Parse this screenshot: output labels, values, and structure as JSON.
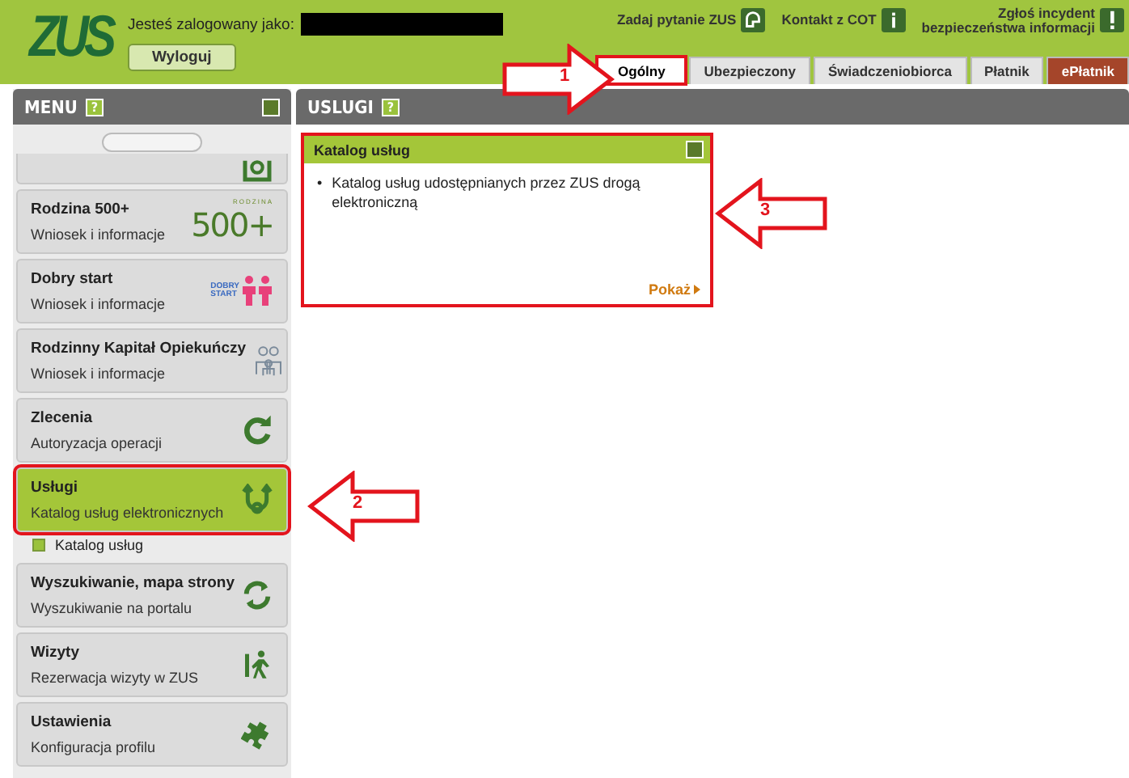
{
  "header": {
    "logo": "ZUS",
    "login_label": "Jesteś zalogowany jako:",
    "logout_button": "Wyloguj",
    "links": [
      {
        "kind": "question",
        "label": "Zadaj pytanie ZUS"
      },
      {
        "kind": "info",
        "label": "Kontakt z COT"
      },
      {
        "kind": "alert",
        "label": "Zgłoś incydent\nbezpieczeństwa informacji"
      }
    ],
    "tabs": [
      {
        "label": "Ogólny",
        "selected": true,
        "kind": "normal",
        "highlighted": true
      },
      {
        "label": "Ubezpieczony",
        "selected": false,
        "kind": "normal",
        "highlighted": false
      },
      {
        "label": "Świadczeniobiorca",
        "selected": false,
        "kind": "normal",
        "highlighted": false
      },
      {
        "label": "Płatnik",
        "selected": false,
        "kind": "normal",
        "highlighted": false
      },
      {
        "label": "ePłatnik",
        "selected": false,
        "kind": "special",
        "highlighted": false
      }
    ]
  },
  "sidebar": {
    "title": "MENU",
    "help": "?",
    "items": [
      {
        "kind": "partial"
      },
      {
        "kind": "item",
        "title": "Rodzina 500+",
        "subtitle": "Wniosek i informacje",
        "logo_lines": [
          "RODZINA",
          "500+"
        ],
        "selected": false,
        "highlighted": false
      },
      {
        "kind": "item",
        "title": "Dobry start",
        "subtitle": "Wniosek i informacje",
        "logo_lines": [
          "DOBRY",
          "START"
        ],
        "selected": false,
        "highlighted": false
      },
      {
        "kind": "item",
        "title": "Rodzinny Kapitał Opiekuńczy",
        "subtitle": "Wniosek i informacje",
        "selected": false,
        "highlighted": false
      },
      {
        "kind": "item",
        "title": "Zlecenia",
        "subtitle": "Autoryzacja operacji",
        "selected": false,
        "highlighted": false
      },
      {
        "kind": "item",
        "title": "Usługi",
        "subtitle": "Katalog usług elektronicznych",
        "selected": true,
        "highlighted": true
      },
      {
        "kind": "subitem",
        "title": "Katalog usług"
      },
      {
        "kind": "item",
        "title": "Wyszukiwanie, mapa strony",
        "subtitle": "Wyszukiwanie na portalu",
        "selected": false,
        "highlighted": false
      },
      {
        "kind": "item",
        "title": "Wizyty",
        "subtitle": "Rezerwacja wizyty w ZUS",
        "selected": false,
        "highlighted": false
      },
      {
        "kind": "item",
        "title": "Ustawienia",
        "subtitle": "Konfiguracja profilu",
        "selected": false,
        "highlighted": false
      }
    ]
  },
  "content": {
    "title": "USLUGI",
    "help": "?",
    "panel": {
      "title": "Katalog usług",
      "highlighted": true,
      "bullets": [
        {
          "marker": "•",
          "text": "Katalog usług udostępnianych przez ZUS drogą elektroniczną"
        }
      ],
      "link": "Pokaż"
    }
  },
  "annotations": [
    {
      "label": "1"
    },
    {
      "label": "2"
    },
    {
      "label": "3"
    }
  ]
}
